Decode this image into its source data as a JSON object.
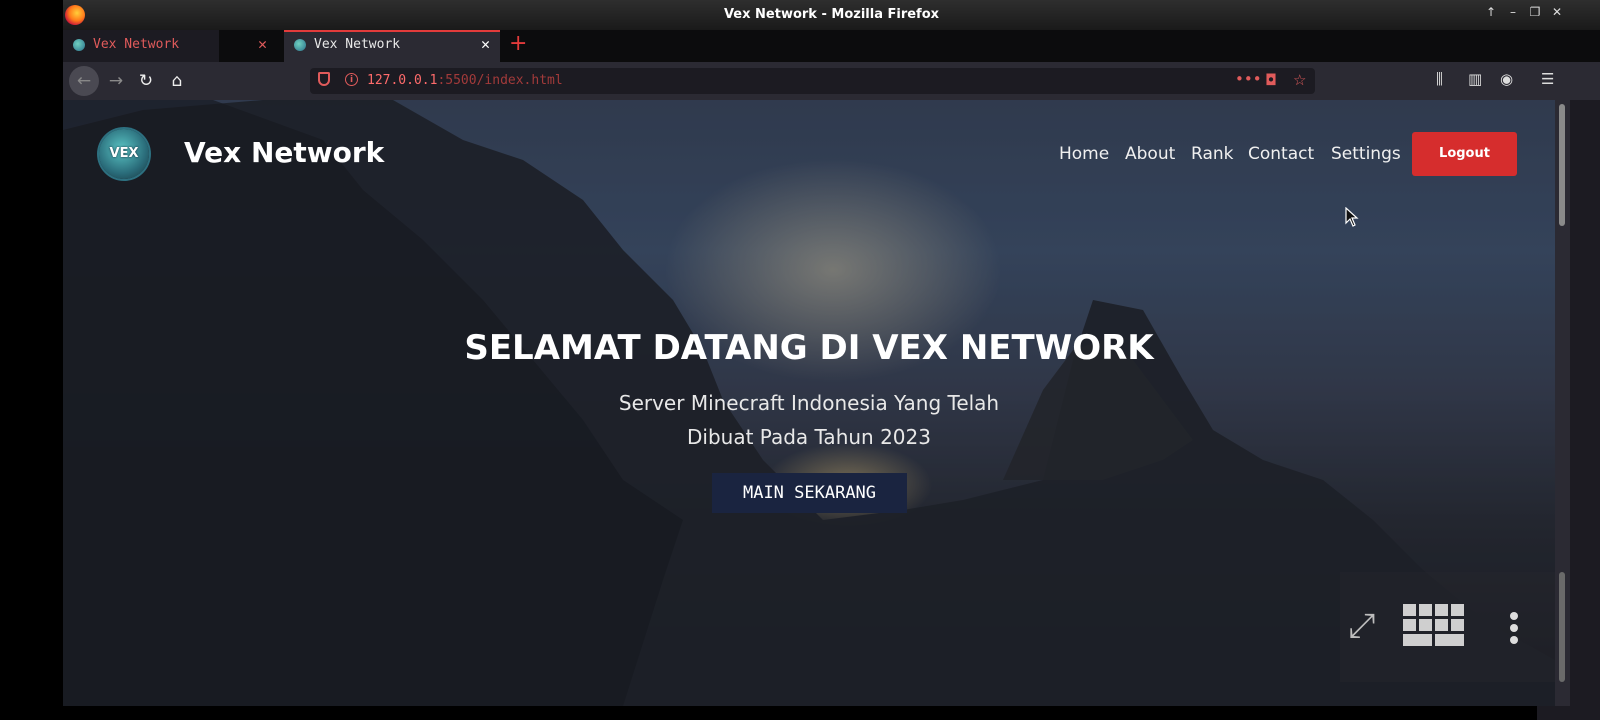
{
  "window": {
    "title": "Vex Network - Mozilla Firefox"
  },
  "tabs": [
    {
      "label": "Vex Network",
      "active": false
    },
    {
      "label": "Vex Network",
      "active": true
    }
  ],
  "toolbar": {
    "url_host": "127.0.0.1",
    "url_path": ":5500/index.html",
    "page_actions_label": "•••"
  },
  "site": {
    "logo_text": "VEX",
    "brand": "Vex Network",
    "nav": [
      "Home",
      "About",
      "Rank",
      "Contact",
      "Settings"
    ],
    "logout_label": "Logout",
    "hero_title": "SELAMAT DATANG DI VEX NETWORK",
    "hero_sub_line1": "Server Minecraft Indonesia Yang Telah",
    "hero_sub_line2": "Dibuat Pada Tahun 2023",
    "play_label": "MAIN SEKARANG"
  },
  "colors": {
    "accent_red": "#d62d2d",
    "play_button": "#1a2440",
    "tab_accent": "#e23b3b"
  },
  "icons": [
    "firefox-icon",
    "globe-icon",
    "close-icon",
    "plus-icon",
    "back-icon",
    "forward-icon",
    "reload-icon",
    "home-icon",
    "shield-icon",
    "info-icon",
    "pocket-icon",
    "star-icon",
    "library-icon",
    "sidebar-icon",
    "account-icon",
    "menu-icon",
    "expand-icon",
    "grid-icon",
    "kebab-icon"
  ]
}
